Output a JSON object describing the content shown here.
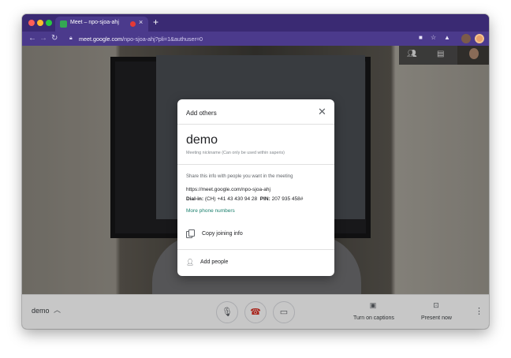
{
  "browser": {
    "tab_title": "Meet – npo-sjoa-ahj",
    "tab_close": "×",
    "new_tab": "+",
    "url_host": "meet.google.com",
    "url_path": "/npo-sjoa-ahj?pli=1&authuser=0",
    "icons": [
      "back-arrow-icon",
      "forward-arrow-icon",
      "reload-icon",
      "lock-icon",
      "camera-icon",
      "star-icon",
      "extension-icon"
    ]
  },
  "meeting": {
    "name": "demo",
    "captions_label": "Turn on captions",
    "present_label": "Present now"
  },
  "dialog": {
    "title": "Add others",
    "meeting_nickname": "demo",
    "nickname_note": "Meeting nickname (Can only be used within saperis)",
    "share_text": "Share this info with people you want in the meeting",
    "meeting_link": "https://meet.google.com/npo-sjoa-ahj",
    "dial_in_label": "Dial-in:",
    "dial_in_number": "(CH) +41 43 430 94 28",
    "pin_label": "PIN:",
    "pin_value": "207 935 458#",
    "more_numbers": "More phone numbers",
    "copy_label": "Copy joining info",
    "add_people_label": "Add people"
  },
  "colors": {
    "browser_frame": "#3a2a73",
    "browser_toolbar": "#4b3a8c",
    "link_green": "#1a7f6c",
    "hangup_red": "#d93025"
  }
}
